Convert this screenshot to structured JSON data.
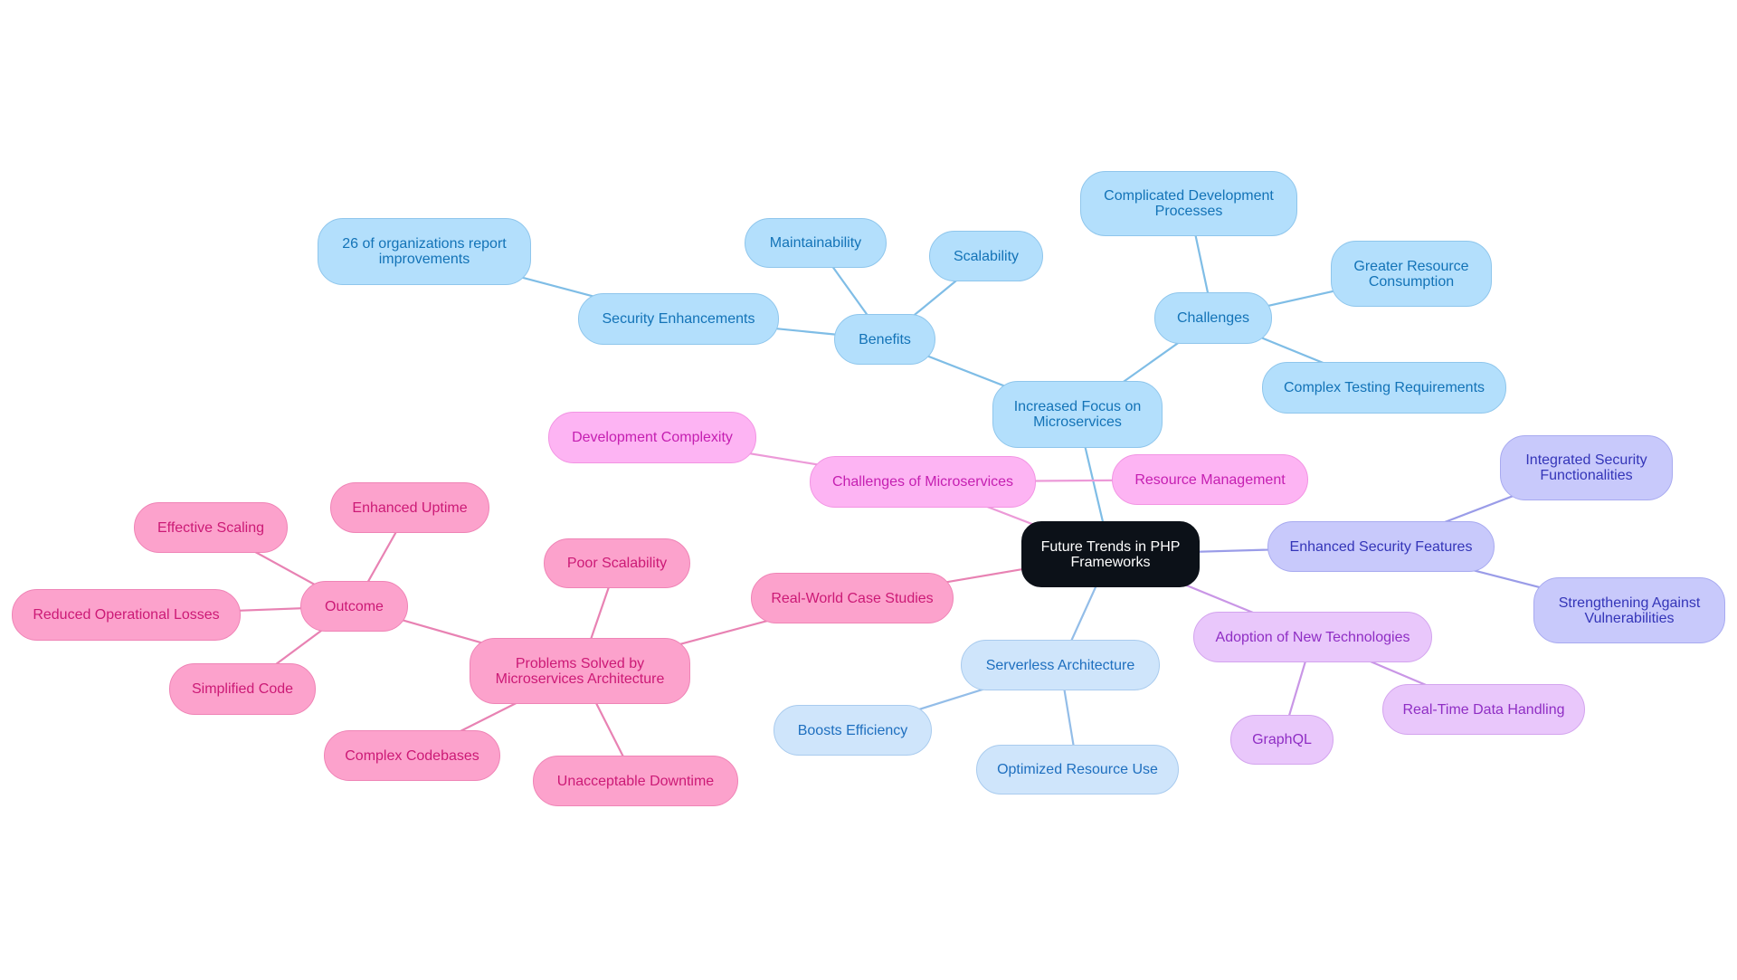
{
  "diagram": {
    "type": "mindmap",
    "root": {
      "id": "root",
      "label": "Future Trends in PHP Frameworks"
    },
    "colors": {
      "root": "#0c1118",
      "microservices_branch": "#b3dffc",
      "serverless_branch": "#cfe5fb",
      "challenges_branch": "#fdb4f3",
      "security_branch": "#c8c9fb",
      "technologies_branch": "#e9c7fb",
      "case_studies_branch": "#fca2cc"
    },
    "nodes": [
      {
        "id": "root",
        "label": "Future Trends in PHP Frameworks",
        "parent": null,
        "style": "root"
      },
      {
        "id": "micro",
        "label": "Increased Focus on Microservices",
        "parent": "root",
        "style": "blue"
      },
      {
        "id": "benefits",
        "label": "Benefits",
        "parent": "micro",
        "style": "blue"
      },
      {
        "id": "sec_enh",
        "label": "Security Enhancements",
        "parent": "benefits",
        "style": "blue"
      },
      {
        "id": "orgs",
        "label": "26 of organizations report improvements",
        "parent": "sec_enh",
        "style": "blue"
      },
      {
        "id": "maint",
        "label": "Maintainability",
        "parent": "benefits",
        "style": "blue"
      },
      {
        "id": "scal",
        "label": "Scalability",
        "parent": "benefits",
        "style": "blue"
      },
      {
        "id": "challenges",
        "label": "Challenges",
        "parent": "micro",
        "style": "blue"
      },
      {
        "id": "comp_dev",
        "label": "Complicated Development Processes",
        "parent": "challenges",
        "style": "blue"
      },
      {
        "id": "greater_res",
        "label": "Greater Resource Consumption",
        "parent": "challenges",
        "style": "blue"
      },
      {
        "id": "complex_test",
        "label": "Complex Testing Requirements",
        "parent": "challenges",
        "style": "blue"
      },
      {
        "id": "ch_micro",
        "label": "Challenges of Microservices",
        "parent": "root",
        "style": "pink"
      },
      {
        "id": "dev_complex",
        "label": "Development Complexity",
        "parent": "ch_micro",
        "style": "pink"
      },
      {
        "id": "res_mgmt",
        "label": "Resource Management",
        "parent": "ch_micro",
        "style": "pink"
      },
      {
        "id": "enh_sec",
        "label": "Enhanced Security Features",
        "parent": "root",
        "style": "indigo"
      },
      {
        "id": "int_sec",
        "label": "Integrated Security Functionalities",
        "parent": "enh_sec",
        "style": "indigo"
      },
      {
        "id": "strength",
        "label": "Strengthening Against Vulnerabilities",
        "parent": "enh_sec",
        "style": "indigo"
      },
      {
        "id": "adoption",
        "label": "Adoption of New Technologies",
        "parent": "root",
        "style": "violet"
      },
      {
        "id": "graphql",
        "label": "GraphQL",
        "parent": "adoption",
        "style": "violet"
      },
      {
        "id": "realtime",
        "label": "Real-Time Data Handling",
        "parent": "adoption",
        "style": "violet"
      },
      {
        "id": "serverless",
        "label": "Serverless Architecture",
        "parent": "root",
        "style": "lblue"
      },
      {
        "id": "boosts",
        "label": "Boosts Efficiency",
        "parent": "serverless",
        "style": "lblue"
      },
      {
        "id": "optimized",
        "label": "Optimized Resource Use",
        "parent": "serverless",
        "style": "lblue"
      },
      {
        "id": "realworld",
        "label": "Real-World Case Studies",
        "parent": "root",
        "style": "rose"
      },
      {
        "id": "problems",
        "label": "Problems Solved by Microservices Architecture",
        "parent": "realworld",
        "style": "rose"
      },
      {
        "id": "poor_scal",
        "label": "Poor Scalability",
        "parent": "problems",
        "style": "rose"
      },
      {
        "id": "outcome",
        "label": "Outcome",
        "parent": "problems",
        "style": "rose"
      },
      {
        "id": "eff_scal",
        "label": "Effective Scaling",
        "parent": "outcome",
        "style": "rose"
      },
      {
        "id": "enh_up",
        "label": "Enhanced Uptime",
        "parent": "outcome",
        "style": "rose"
      },
      {
        "id": "reduced",
        "label": "Reduced Operational Losses",
        "parent": "outcome",
        "style": "rose"
      },
      {
        "id": "simplified",
        "label": "Simplified Code",
        "parent": "outcome",
        "style": "rose"
      },
      {
        "id": "complex_code",
        "label": "Complex Codebases",
        "parent": "problems",
        "style": "rose"
      },
      {
        "id": "unacc",
        "label": "Unacceptable Downtime",
        "parent": "problems",
        "style": "rose"
      }
    ],
    "text_lines": {
      "root": [
        "Future Trends in PHP",
        "Frameworks"
      ],
      "micro": [
        "Increased Focus on",
        "Microservices"
      ],
      "orgs": [
        "26 of organizations report",
        "improvements"
      ],
      "comp_dev": [
        "Complicated Development",
        "Processes"
      ],
      "greater_res": [
        "Greater Resource",
        "Consumption"
      ],
      "int_sec": [
        "Integrated Security",
        "Functionalities"
      ],
      "strength": [
        "Strengthening Against",
        "Vulnerabilities"
      ],
      "problems": [
        "Problems Solved by",
        "Microservices Architecture"
      ]
    }
  }
}
